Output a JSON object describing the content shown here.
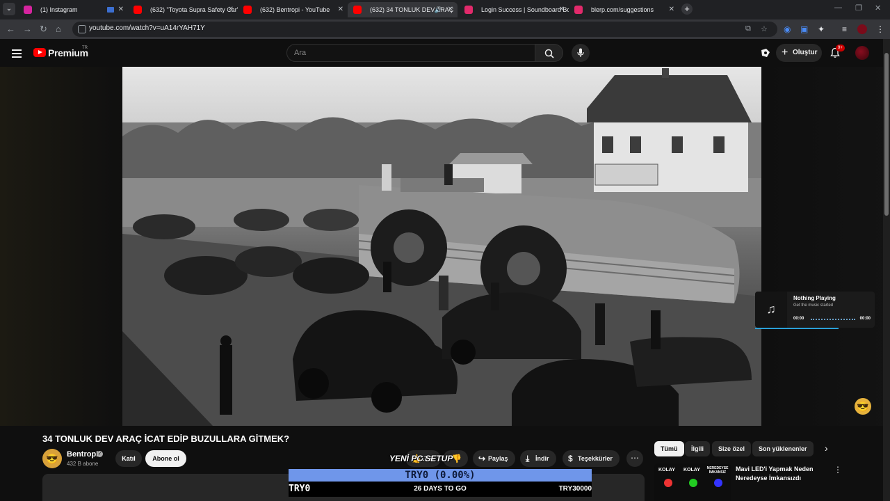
{
  "browser": {
    "tabs": [
      {
        "title": "(1) Instagram",
        "favicon_color": "#d6249f"
      },
      {
        "title": "(632) \"Toyota Supra Safety Car\"",
        "favicon_color": "#ff0000"
      },
      {
        "title": "(632) Bentropi - YouTube",
        "favicon_color": "#ff0000"
      },
      {
        "title": "(632) 34 TONLUK DEV ARAÇ",
        "favicon_color": "#ff0000"
      },
      {
        "title": "Login Success | Soundboard Bo",
        "favicon_color": "#e22a6b"
      },
      {
        "title": "blerp.com/suggestions",
        "favicon_color": "#e22a6b"
      }
    ],
    "active_tab_index": 3,
    "url": "youtube.com/watch?v=uA14rYAH71Y"
  },
  "youtube": {
    "brand": "Premium",
    "region": "TR",
    "search_placeholder": "Ara",
    "create_label": "Oluştur",
    "notification_count": "9+"
  },
  "video": {
    "title": "34 TONLUK DEV ARAÇ İCAT EDİP BUZULLARA GİTMEK?",
    "channel": "Bentropi",
    "subscribers": "432 B abone",
    "join_label": "Katıl",
    "subscribe_label": "Abone ol",
    "like_count": "17 B",
    "share_label": "Paylaş",
    "download_label": "İndir",
    "thanks_label": "Teşekkürler"
  },
  "music_widget": {
    "title": "Nothing Playing",
    "subtitle": "Get the music started",
    "time_start": "00:00",
    "time_end": "00:00"
  },
  "chips": [
    "Tümü",
    "İlgili",
    "Size özel",
    "Son yüklenenler"
  ],
  "recommendation": {
    "thumb_tags": [
      "KOLAY",
      "KOLAY",
      "NEREDEYSE İMKANSIZ"
    ],
    "title": "Mavi LED'i Yapmak Neden Neredeyse İmkansızdı"
  },
  "overlay": {
    "title": "YENİ PC SETUP",
    "progress_text": "TRY0 (0.00%)",
    "progress_fraction": 0.0,
    "left": "TRY0",
    "middle": "26 DAYS TO GO",
    "right": "TRY30000"
  },
  "colors": {
    "yt_red": "#ff0000",
    "overlay_bar": "#6f96ea",
    "music_progress": "#2aa0d8"
  }
}
